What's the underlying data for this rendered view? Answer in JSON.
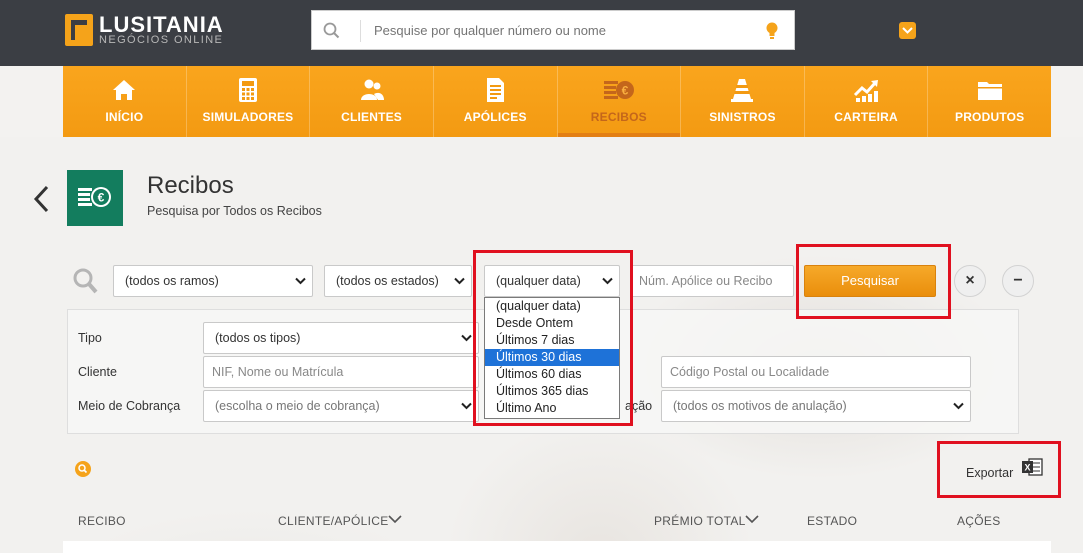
{
  "brand": {
    "name": "LUSITANIA",
    "tagline": "NEGÓCIOS ONLINE",
    "accent": "#f5a31a",
    "topbar_color": "#3b3e44"
  },
  "top_search": {
    "placeholder": "Pesquise por qualquer número ou nome",
    "icon": "search-icon",
    "hint_icon": "lightbulb-icon"
  },
  "nav": {
    "items": [
      {
        "label": "INÍCIO",
        "icon": "home-icon",
        "active": false
      },
      {
        "label": "SIMULADORES",
        "icon": "calculator-icon",
        "active": false
      },
      {
        "label": "CLIENTES",
        "icon": "people-icon",
        "active": false
      },
      {
        "label": "APÓLICES",
        "icon": "document-icon",
        "active": false
      },
      {
        "label": "RECIBOS",
        "icon": "euro-coins-icon",
        "active": true
      },
      {
        "label": "SINISTROS",
        "icon": "traffic-cone-icon",
        "active": false
      },
      {
        "label": "CARTEIRA",
        "icon": "growth-chart-icon",
        "active": false
      },
      {
        "label": "PRODUTOS",
        "icon": "folder-icon",
        "active": false
      }
    ]
  },
  "page": {
    "title": "Recibos",
    "subtitle": "Pesquisa por Todos os Recibos",
    "icon": "euro-coins-icon",
    "icon_color": "#137d5e"
  },
  "filters": {
    "ramos": "(todos os ramos)",
    "estados": "(todos os estados)",
    "data": "(qualquer data)",
    "apolice_placeholder": "Núm. Apólice ou Recibo",
    "search_button": "Pesquisar",
    "clear_button": "×",
    "collapse_button": "−"
  },
  "date_dropdown": {
    "options": [
      "(qualquer data)",
      "Desde Ontem",
      "Últimos 7 dias",
      "Últimos 30 dias",
      "Últimos 60 dias",
      "Últimos 365 dias",
      "Último Ano"
    ],
    "highlighted": "Últimos 30 dias"
  },
  "advanced": {
    "tipo_label": "Tipo",
    "tipo_value": "(todos os tipos)",
    "cliente_label": "Cliente",
    "cliente_placeholder": "NIF, Nome ou Matrícula",
    "postal_placeholder": "Código Postal ou Localidade",
    "meio_label": "Meio de Cobrança",
    "meio_value": "(escolha o meio de cobrança)",
    "anulacao_label_partial": "ação",
    "anulacao_value": "(todos os motivos de anulação)"
  },
  "results": {
    "export_label": "Exportar",
    "columns": [
      "RECIBO",
      "CLIENTE/APÓLICE",
      "PRÉMIO TOTAL",
      "ESTADO",
      "AÇÕES"
    ]
  },
  "highlight_color": "#e0101f"
}
